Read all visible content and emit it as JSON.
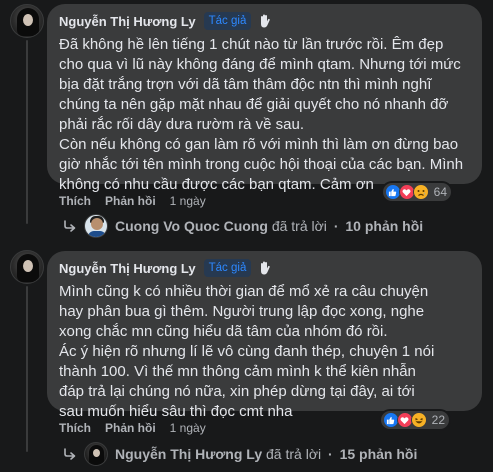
{
  "comments": [
    {
      "author": "Nguyễn Thị Hương Ly",
      "badge": "Tác giả",
      "text": "Đã không hề lên tiếng 1 chút nào từ lần trước rồi. Êm đẹp cho qua vì lũ này không đáng để mình qtam. Nhưng tới mức bịa đặt trắng trợn với dã tâm thâm độc ntn thì mình nghĩ chúng ta nên gặp mặt nhau để giải quyết cho nó nhanh đỡ phải rắc rối dây dưa rườm rà về sau.\nCòn nếu không có gan làm rõ với mình thì làm ơn đừng bao giờ nhắc tới tên mình trong cuộc hội thoại của các bạn. Mình không có nhu cầu được các bạn qtam. Cảm ơn",
      "reaction_count": "64",
      "like_label": "Thích",
      "reply_label": "Phản hồi",
      "time": "1 ngày",
      "replies_summary": {
        "replier": "Cuong Vo Quoc Cuong",
        "action": "đã trả lời",
        "separator": "·",
        "count": "10 phản hồi"
      }
    },
    {
      "author": "Nguyễn Thị Hương Ly",
      "badge": "Tác giả",
      "text": "Mình cũng k có nhiều thời gian để mổ xẻ ra câu chuyện hay phân bua gì thêm. Người trung lập đọc xong, nghe xong chắc mn cũng hiểu dã tâm của nhóm đó rồi.\nÁc ý hiện rõ nhưng lí lẽ vô cùng đanh thép, chuyện 1 nói thành 100. Vì thế mn thông cảm mình k thể kiên nhẫn đáp trả lại chúng nó nữa, xin phép dừng tại đây, ai tới sau muốn hiểu sâu thì đọc cmt nha",
      "reaction_count": "22",
      "like_label": "Thích",
      "reply_label": "Phản hồi",
      "time": "1 ngày",
      "replies_summary": {
        "replier": "Nguyễn Thị Hương Ly",
        "action": "đã trả lời",
        "separator": "·",
        "count": "15 phản hồi"
      }
    }
  ],
  "colors": {
    "background": "#18191a",
    "bubble": "#3a3b3c",
    "text": "#e4e6eb",
    "muted": "#b0b3b8",
    "badge_bg": "#263951",
    "badge_text": "#2d88ff",
    "like": "#1877f2",
    "love": "#f33e58",
    "sad": "#f7b125"
  },
  "icons": {
    "wave": "waving-hand-icon",
    "reply_arrow": "reply-arrow-icon",
    "like": "like-reaction-icon",
    "love": "love-reaction-icon",
    "sad": "sad-reaction-icon",
    "haha": "haha-reaction-icon"
  }
}
